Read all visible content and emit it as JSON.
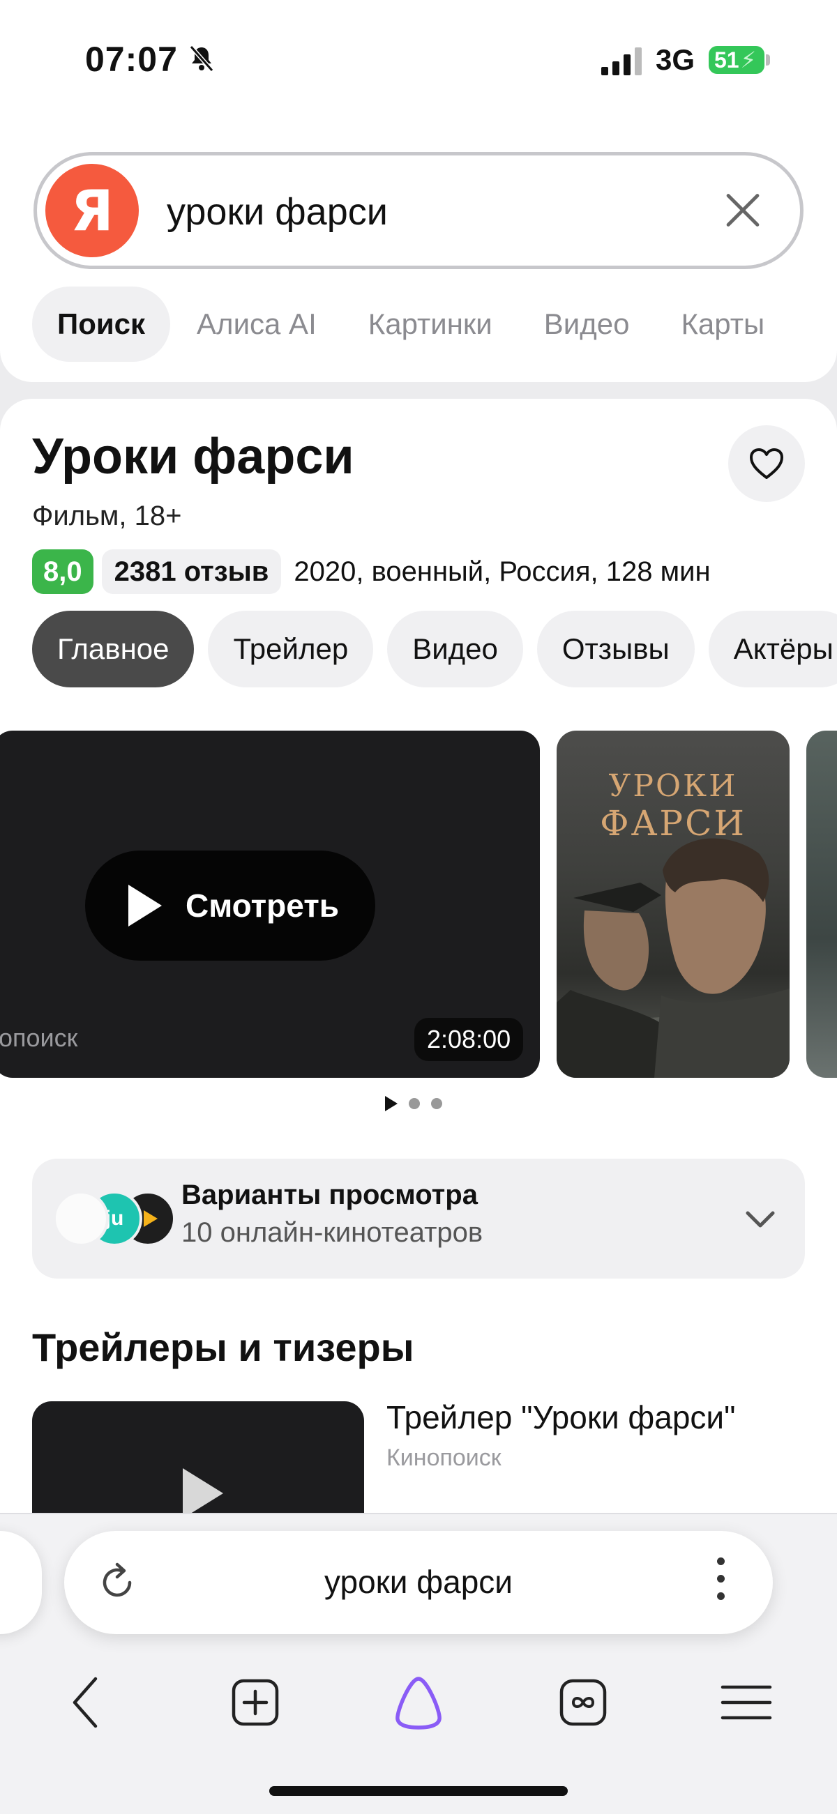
{
  "status_bar": {
    "time": "07:07",
    "network": "3G",
    "battery": "51"
  },
  "search": {
    "query": "уроки фарси",
    "logo_letter": "Я"
  },
  "verticals": [
    {
      "label": "Поиск"
    },
    {
      "label": "Алиса AI"
    },
    {
      "label": "Картинки"
    },
    {
      "label": "Видео"
    },
    {
      "label": "Карты"
    }
  ],
  "film": {
    "title": "Уроки фарси",
    "subtitle": "Фильм, 18+",
    "rating": "8,0",
    "reviews": "2381 отзыв",
    "meta": "2020, военный, Россия, 128 мин"
  },
  "chips": [
    {
      "label": "Главное"
    },
    {
      "label": "Трейлер"
    },
    {
      "label": "Видео"
    },
    {
      "label": "Отзывы"
    },
    {
      "label": "Актёры"
    }
  ],
  "player": {
    "watch_label": "Смотреть",
    "provider": "опоиск",
    "duration": "2:08:00"
  },
  "poster": {
    "line1": "УРОКИ",
    "line2": "ФАРСИ"
  },
  "variants": {
    "title": "Варианты просмотра",
    "subtitle": "10 онлайн-кинотеатров",
    "icon2_text": "ju"
  },
  "trailers": {
    "section_title": "Трейлеры и тизеры",
    "items": [
      {
        "title": "Трейлер \"Уроки фарси\"",
        "source": "Кинопоиск"
      }
    ]
  },
  "browser": {
    "url_text": "уроки фарси"
  },
  "colors": {
    "accent_logo": "#f55a3e",
    "rating_green": "#3bb54a",
    "alice_purple": "#8a5cf6"
  }
}
